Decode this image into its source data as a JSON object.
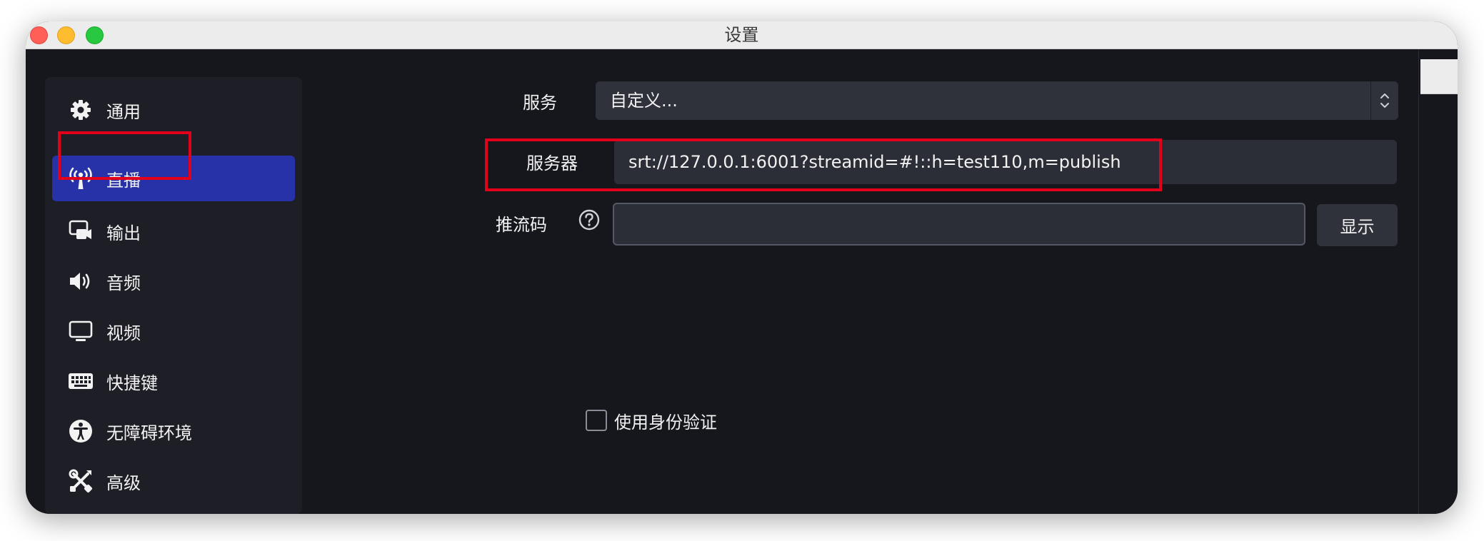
{
  "window": {
    "title": "设置"
  },
  "sidebar": {
    "items": [
      {
        "label": "通用",
        "icon": "gear-icon"
      },
      {
        "label": "直播",
        "icon": "broadcast-antenna-icon",
        "active": true
      },
      {
        "label": "输出",
        "icon": "output-camera-icon"
      },
      {
        "label": "音频",
        "icon": "speaker-icon"
      },
      {
        "label": "视频",
        "icon": "monitor-icon"
      },
      {
        "label": "快捷键",
        "icon": "keyboard-icon"
      },
      {
        "label": "无障碍环境",
        "icon": "accessibility-icon"
      },
      {
        "label": "高级",
        "icon": "tools-icon"
      }
    ]
  },
  "stream": {
    "service_label": "服务",
    "service_value": "自定义...",
    "server_label": "服务器",
    "server_value": "srt://127.0.0.1:6001?streamid=#!::h=test110,m=publish",
    "key_label": "推流码",
    "key_value": "",
    "show_button": "显示",
    "auth_label": "使用身份验证",
    "auth_checked": false
  },
  "colors": {
    "background": "#16171d",
    "sidebar": "#1e1f26",
    "active_item": "#2832a8",
    "field": "#2c2e37",
    "highlight": "#e2001a"
  }
}
